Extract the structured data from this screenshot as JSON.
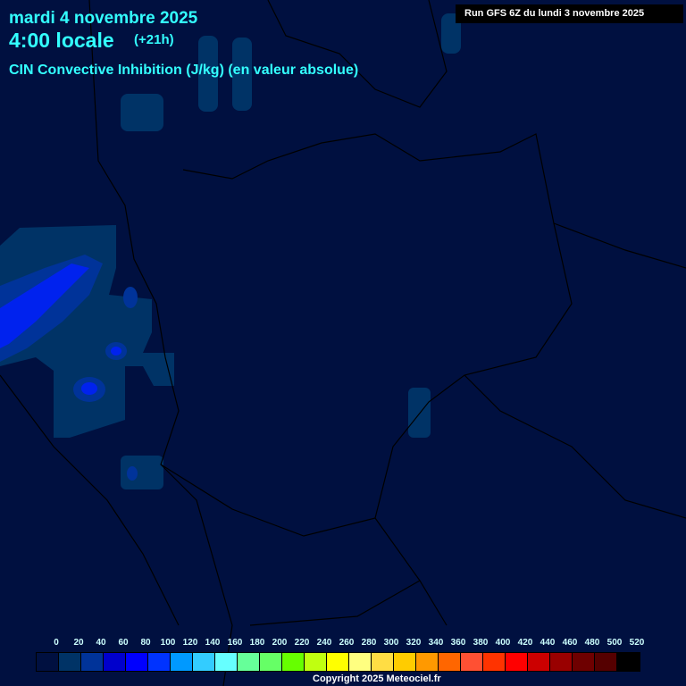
{
  "header": {
    "date": "mardi 4 novembre 2025",
    "time": "4:00 locale",
    "lead": "(+21h)",
    "parameter": "CIN Convective Inhibition (J/kg) (en valeur absolue)",
    "run": "Run GFS 6Z du lundi 3 novembre 2025"
  },
  "legend": {
    "labels": [
      "0",
      "20",
      "40",
      "60",
      "80",
      "100",
      "120",
      "140",
      "160",
      "180",
      "200",
      "220",
      "240",
      "260",
      "280",
      "300",
      "320",
      "340",
      "360",
      "380",
      "400",
      "420",
      "440",
      "460",
      "480",
      "500",
      "520"
    ],
    "colors": [
      "#001040",
      "#003366",
      "#003399",
      "#0000cc",
      "#0000ff",
      "#0033ff",
      "#0099ff",
      "#33ccff",
      "#66ffff",
      "#66ff99",
      "#66ff66",
      "#66ff00",
      "#c0ff10",
      "#ffff00",
      "#ffff80",
      "#ffdd44",
      "#ffcc00",
      "#ff9900",
      "#ff6600",
      "#ff5033",
      "#ff3300",
      "#ff0000",
      "#cc0000",
      "#990000",
      "#6e0000",
      "#550000",
      "#000000"
    ]
  },
  "copyright": "Copyright 2025 Meteociel.fr"
}
